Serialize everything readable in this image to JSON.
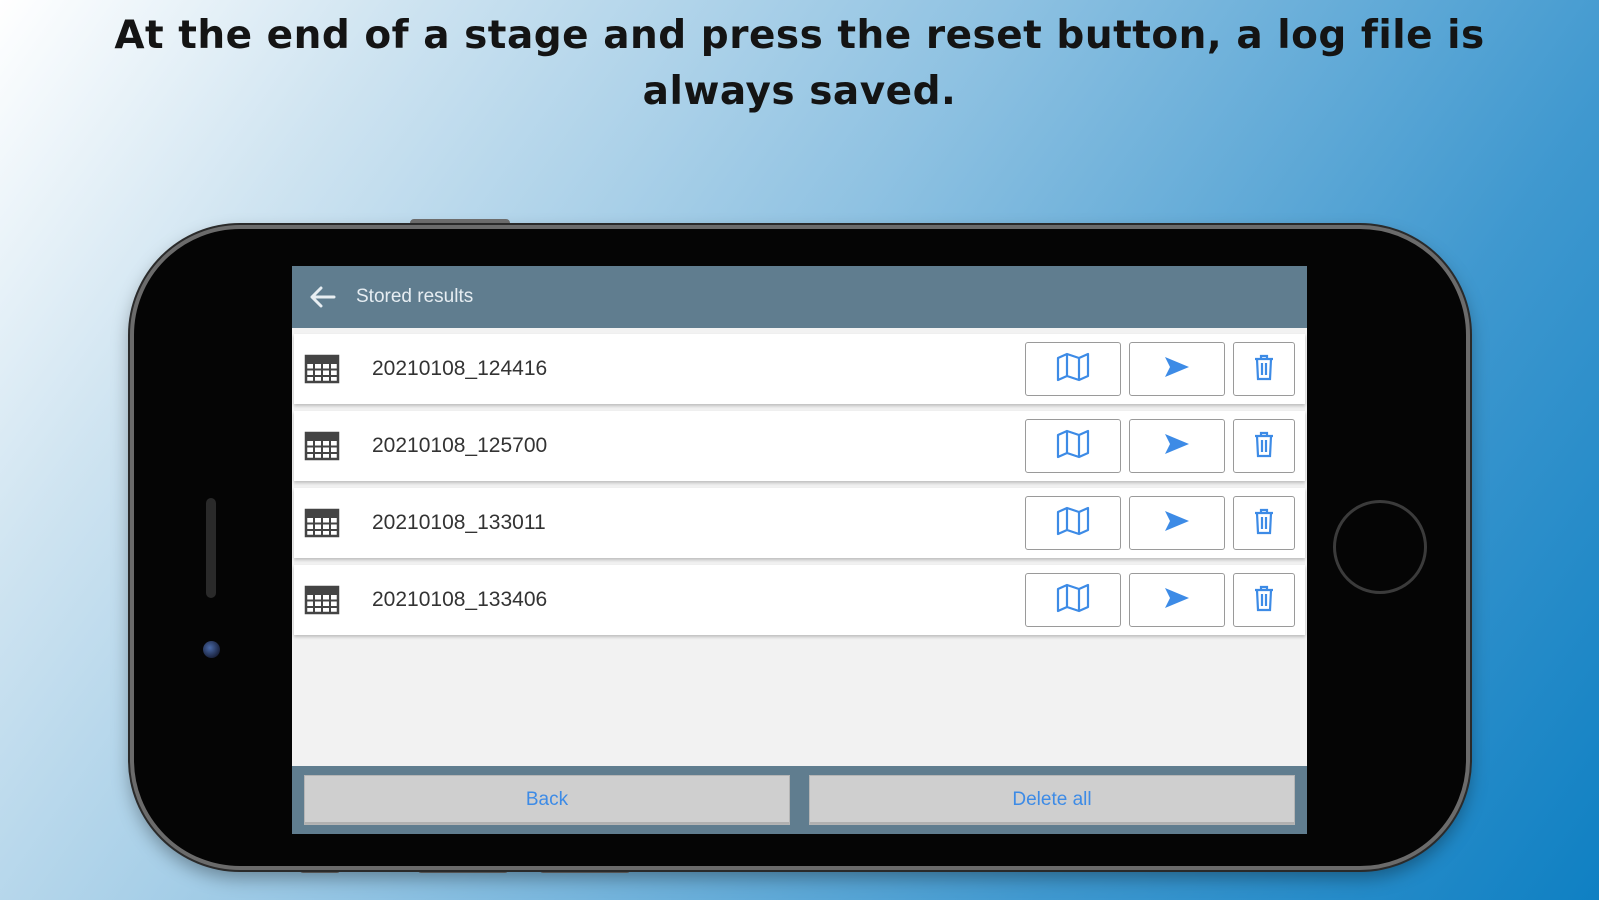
{
  "headline": "At the end of a stage and press the reset button, a log file is always saved.",
  "app": {
    "title": "Stored results",
    "icons": {
      "back": "arrow-left-icon",
      "file": "table-grid-icon",
      "map": "map-icon",
      "send": "send-icon",
      "delete": "trash-icon"
    },
    "colors": {
      "appbar": "#607d8f",
      "accent": "#3d8be6"
    }
  },
  "results": [
    {
      "name": "20210108_124416"
    },
    {
      "name": "20210108_125700"
    },
    {
      "name": "20210108_133011"
    },
    {
      "name": "20210108_133406"
    }
  ],
  "buttons": {
    "back": "Back",
    "delete_all": "Delete all"
  }
}
